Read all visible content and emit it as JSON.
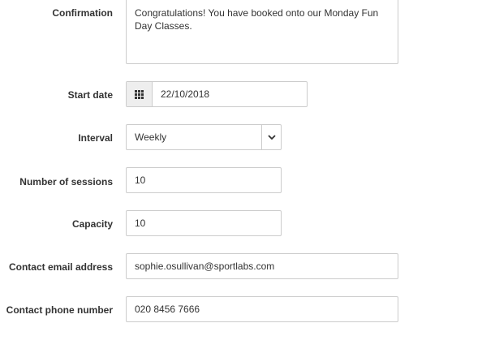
{
  "form": {
    "confirmation": {
      "label": "Confirmation",
      "value": "Congratulations! You have booked onto our Monday Fun Day Classes."
    },
    "start_date": {
      "label": "Start date",
      "value": "22/10/2018",
      "icon": "calendar-grid-icon"
    },
    "interval": {
      "label": "Interval",
      "value": "Weekly",
      "icon": "chevron-down-icon"
    },
    "sessions": {
      "label": "Number of sessions",
      "value": "10"
    },
    "capacity": {
      "label": "Capacity",
      "value": "10"
    },
    "email": {
      "label": "Contact email address",
      "value": "sophie.osullivan@sportlabs.com"
    },
    "phone": {
      "label": "Contact phone number",
      "value": "020 8456 7666"
    }
  }
}
